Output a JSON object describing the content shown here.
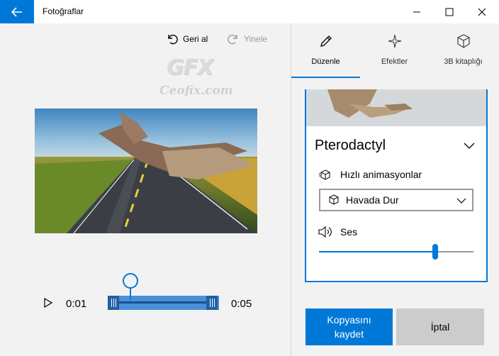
{
  "window": {
    "title": "Fotoğraflar"
  },
  "toolbar": {
    "undo_label": "Geri al",
    "redo_label": "Yinele"
  },
  "watermark": {
    "logo": "GFX",
    "url": "Ceofix.com"
  },
  "timeline": {
    "start_time": "0:01",
    "end_time": "0:05"
  },
  "tabs": [
    {
      "label": "Düzenle",
      "icon": "pencil-icon",
      "selected": true
    },
    {
      "label": "Efektler",
      "icon": "sparkle-icon",
      "selected": false
    },
    {
      "label": "3B kitaplığı",
      "icon": "cube-icon",
      "selected": false
    }
  ],
  "panel": {
    "model_name": "Pterodactyl",
    "animations_label": "Hızlı animasyonlar",
    "animation_selected": "Havada Dur",
    "sound_label": "Ses",
    "volume": 0.75
  },
  "buttons": {
    "save_line1": "Kopyasını",
    "save_line2": "kaydet",
    "cancel": "İptal"
  },
  "colors": {
    "accent": "#0078d7"
  }
}
